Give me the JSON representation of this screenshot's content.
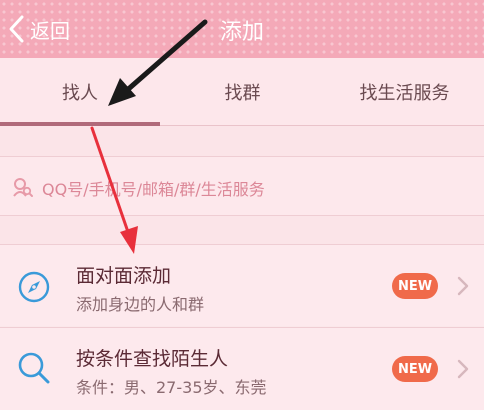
{
  "titlebar": {
    "back_label": "返回",
    "title": "添加"
  },
  "tabs": [
    {
      "label": "找人",
      "selected": true
    },
    {
      "label": "找群",
      "selected": false
    },
    {
      "label": "找生活服务",
      "selected": false
    }
  ],
  "search": {
    "placeholder": "QQ号/手机号/邮箱/群/生活服务",
    "icon": "person-search-icon"
  },
  "items": [
    {
      "title": "面对面添加",
      "subtitle": "添加身边的人和群",
      "badge": "NEW",
      "icon": "compass-icon"
    },
    {
      "title": "按条件查找陌生人",
      "subtitle": "条件：男、27-35岁、东莞",
      "badge": "NEW",
      "icon": "magnifier-icon"
    }
  ],
  "colors": {
    "titlebar": "#f4a9b8",
    "accent_underline": "#b06a7a",
    "badge": "#f06a4a",
    "annotation_arrow_dark": "#1a1a1a",
    "annotation_arrow_red": "#e8303c",
    "icon_blue": "#3a9ad9"
  }
}
